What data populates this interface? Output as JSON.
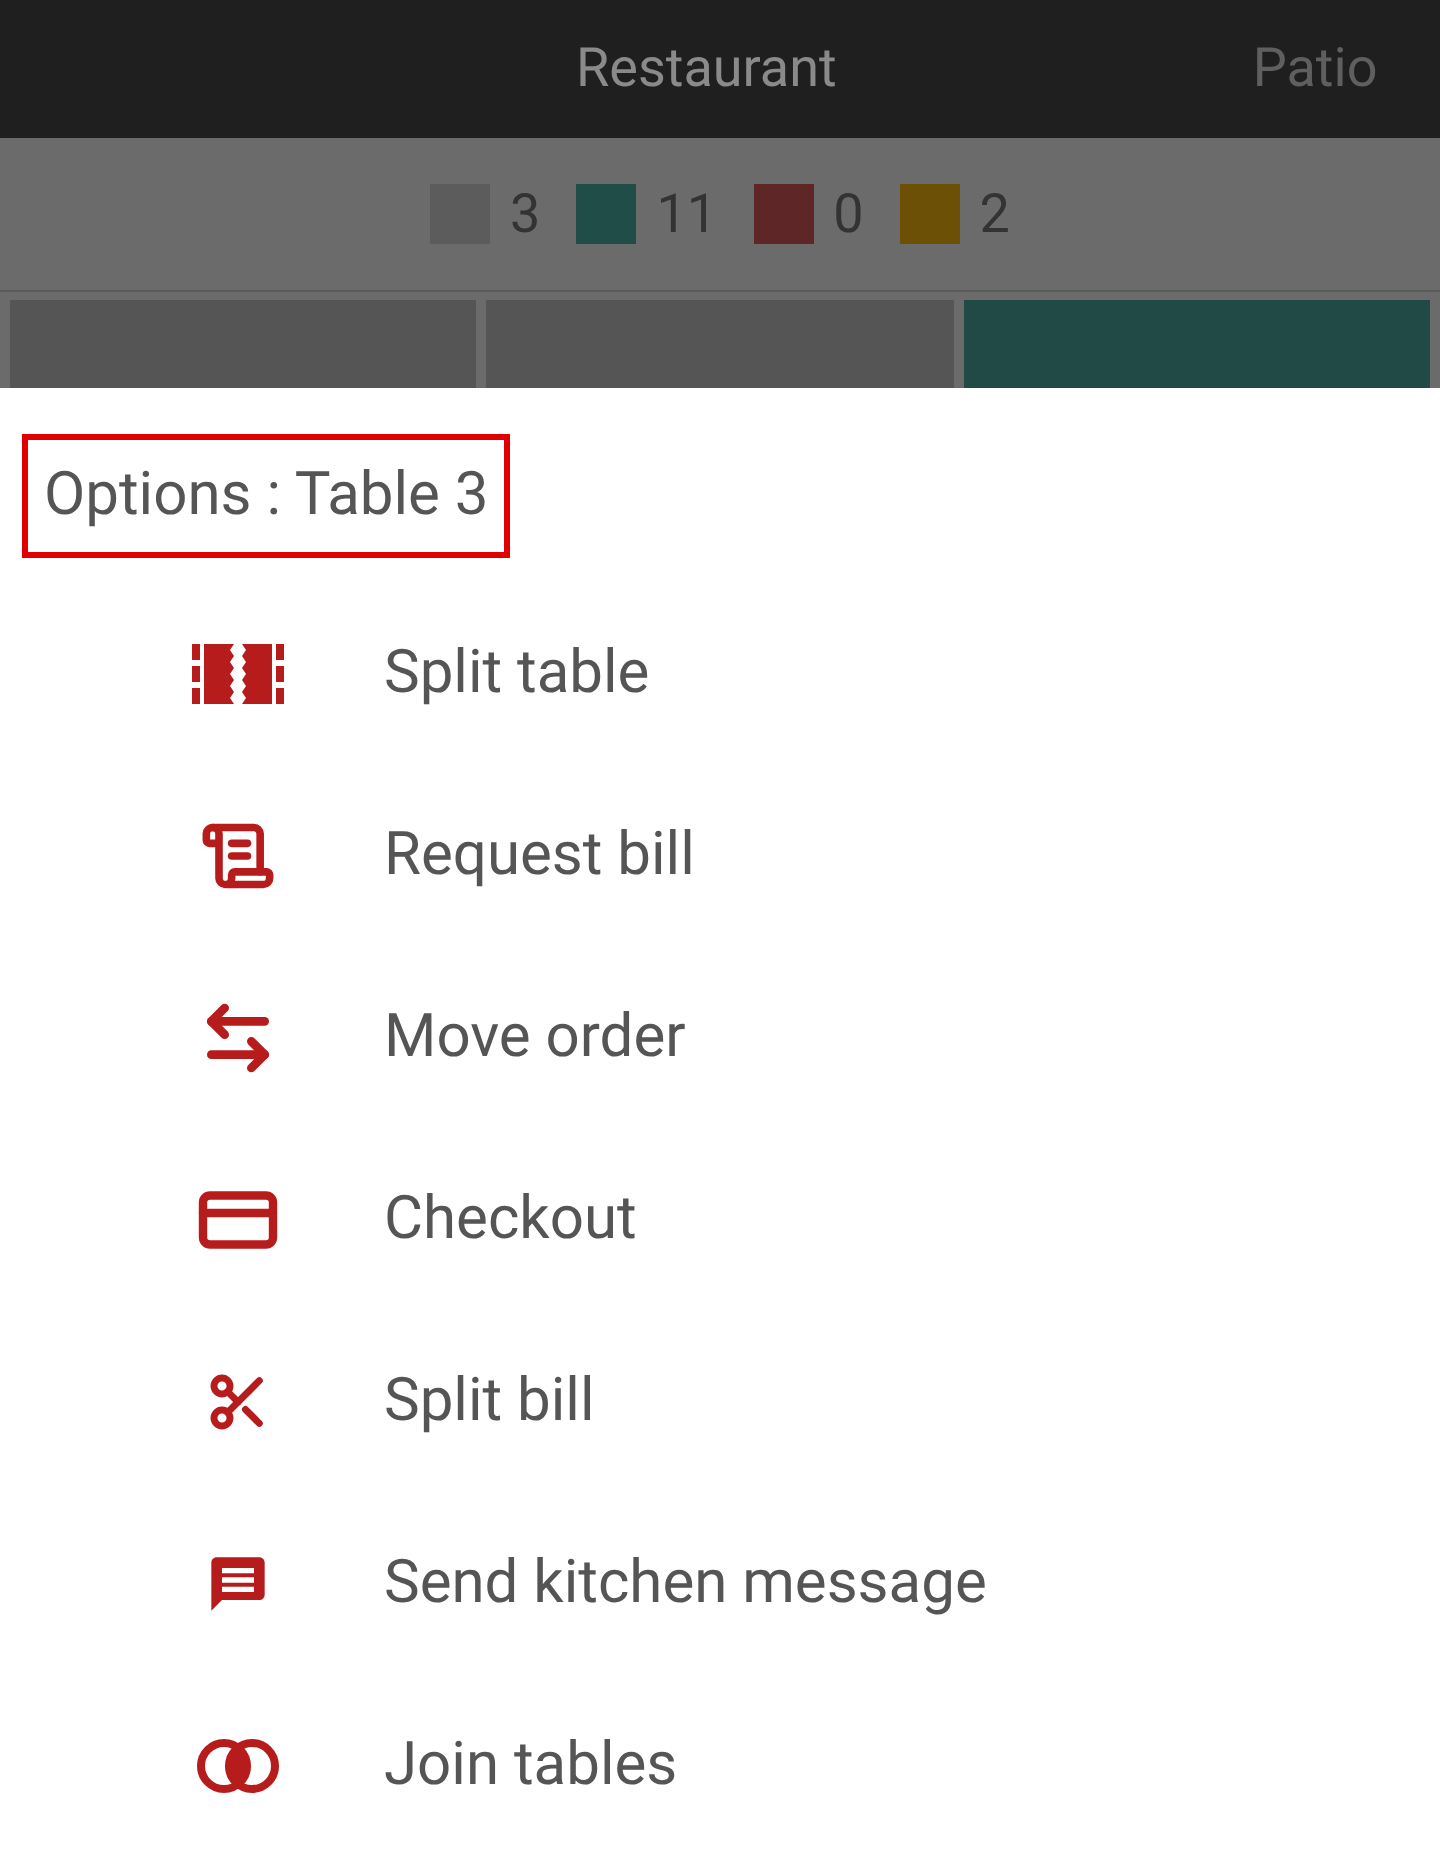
{
  "tabs": [
    {
      "label": "Restaurant",
      "selected": true
    },
    {
      "label": "Patio",
      "selected": false
    }
  ],
  "legend": [
    {
      "count": "3",
      "color": "#5c5c5c"
    },
    {
      "count": "11",
      "color": "#214d48"
    },
    {
      "count": "0",
      "color": "#5e2626"
    },
    {
      "count": "2",
      "color": "#6b5005"
    }
  ],
  "tables": [
    {
      "color": "#555555"
    },
    {
      "color": "#555555"
    },
    {
      "color": "#214a46"
    }
  ],
  "dialog": {
    "title": "Options : Table 3",
    "options": [
      {
        "kind": "split-table",
        "label": "Split table"
      },
      {
        "kind": "bill",
        "label": "Request bill"
      },
      {
        "kind": "move",
        "label": "Move order"
      },
      {
        "kind": "checkout",
        "label": "Checkout"
      },
      {
        "kind": "split-bill",
        "label": "Split bill"
      },
      {
        "kind": "message",
        "label": "Send kitchen message"
      },
      {
        "kind": "join",
        "label": "Join tables"
      }
    ]
  }
}
